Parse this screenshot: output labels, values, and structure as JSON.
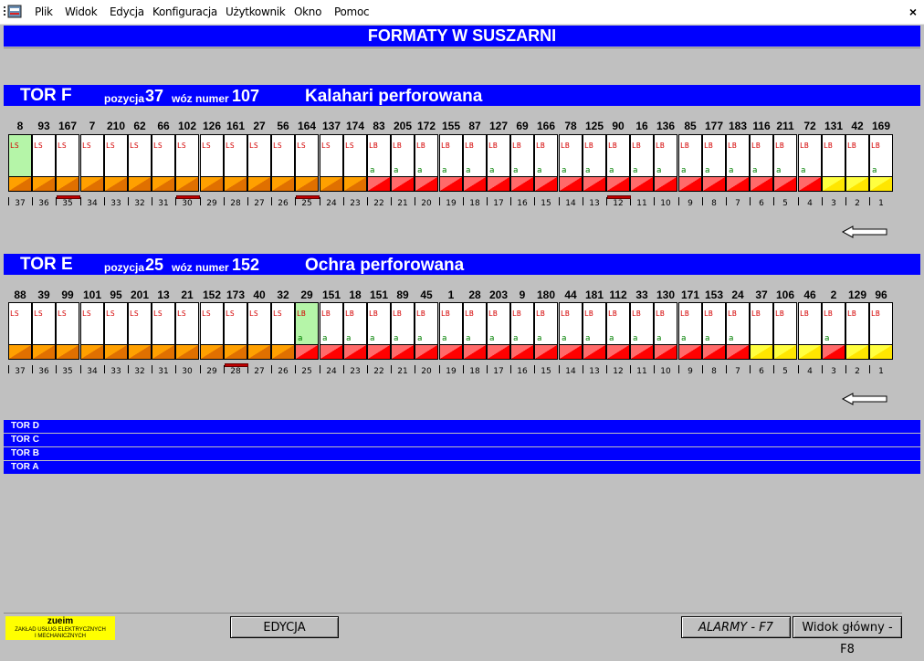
{
  "menu": {
    "items": [
      "Plik",
      "Widok",
      "Edycja",
      "Konfiguracja",
      "Użytkownik",
      "Okno",
      "Pomoc"
    ],
    "close_label": "×"
  },
  "title": "FORMATY W SUSZARNI",
  "tracks": [
    {
      "name": "TOR F",
      "position_label": "pozycja",
      "position": "37",
      "car_label": "wóz numer",
      "car_number": "107",
      "format": "Kalahari perforowana",
      "numbers": [
        "8",
        "93",
        "167",
        "7",
        "210",
        "62",
        "66",
        "102",
        "126",
        "161",
        "27",
        "56",
        "164",
        "137",
        "174",
        "83",
        "205",
        "172",
        "155",
        "87",
        "127",
        "69",
        "166",
        "78",
        "125",
        "90",
        "16",
        "136",
        "85",
        "177",
        "183",
        "116",
        "211",
        "72",
        "131",
        "42",
        "169"
      ],
      "codes": [
        "LS",
        "LS",
        "LS",
        "LS",
        "LS",
        "LS",
        "LS",
        "LS",
        "LS",
        "LS",
        "LS",
        "LS",
        "LS",
        "LS",
        "LS",
        "LB",
        "LB",
        "LB",
        "LB",
        "LB",
        "LB",
        "LB",
        "LB",
        "LB",
        "LB",
        "LB",
        "LB",
        "LB",
        "LB",
        "LB",
        "LB",
        "LB",
        "LB",
        "LB",
        "LB",
        "LB",
        "LB"
      ],
      "subs": [
        "",
        "",
        "",
        "",
        "",
        "",
        "",
        "",
        "",
        "",
        "",
        "",
        "",
        "",
        "",
        "a",
        "a",
        "a",
        "a",
        "a",
        "a",
        "a",
        "a",
        "a",
        "a",
        "a",
        "a",
        "a",
        "a",
        "a",
        "a",
        "a",
        "a",
        "a",
        "",
        "",
        "a"
      ],
      "colors": [
        "orange",
        "orange",
        "orange",
        "orange",
        "orange",
        "orange",
        "orange",
        "orange",
        "orange",
        "orange",
        "orange",
        "orange",
        "orange",
        "orange",
        "orange",
        "red",
        "red",
        "red",
        "red",
        "red",
        "red",
        "red",
        "red",
        "red",
        "red",
        "red",
        "red",
        "red",
        "red",
        "red",
        "red",
        "red",
        "red",
        "red",
        "yellow",
        "yellow",
        "yellow"
      ],
      "green_slot": 1,
      "positions": [
        "37",
        "36",
        "35",
        "34",
        "33",
        "32",
        "31",
        "30",
        "29",
        "28",
        "27",
        "26",
        "25",
        "24",
        "23",
        "22",
        "21",
        "20",
        "19",
        "18",
        "17",
        "16",
        "15",
        "14",
        "13",
        "12",
        "11",
        "10",
        "9",
        "8",
        "7",
        "6",
        "5",
        "4",
        "3",
        "2",
        "1"
      ],
      "markers": [
        3,
        8,
        13,
        26
      ]
    },
    {
      "name": "TOR E",
      "position_label": "pozycja",
      "position": "25",
      "car_label": "wóz numer",
      "car_number": "152",
      "format": "Ochra perforowana",
      "numbers": [
        "88",
        "39",
        "99",
        "101",
        "95",
        "201",
        "13",
        "21",
        "152",
        "173",
        "40",
        "32",
        "29",
        "151",
        "18",
        "151",
        "89",
        "45",
        "1",
        "28",
        "203",
        "9",
        "180",
        "44",
        "181",
        "112",
        "33",
        "130",
        "171",
        "153",
        "24",
        "37",
        "106",
        "46",
        "2",
        "129",
        "96"
      ],
      "codes": [
        "LS",
        "LS",
        "LS",
        "LS",
        "LS",
        "LS",
        "LS",
        "LS",
        "LS",
        "LS",
        "LS",
        "LS",
        "LB",
        "LB",
        "LB",
        "LB",
        "LB",
        "LB",
        "LB",
        "LB",
        "LB",
        "LB",
        "LB",
        "LB",
        "LB",
        "LB",
        "LB",
        "LB",
        "LB",
        "LB",
        "LB",
        "LB",
        "LB",
        "LB",
        "LB",
        "LB",
        "LB"
      ],
      "subs": [
        "",
        "",
        "",
        "",
        "",
        "",
        "",
        "",
        "",
        "",
        "",
        "",
        "a",
        "a",
        "a",
        "a",
        "a",
        "a",
        "a",
        "a",
        "a",
        "a",
        "a",
        "a",
        "a",
        "a",
        "a",
        "a",
        "a",
        "a",
        "a",
        "",
        "",
        "",
        "a",
        "",
        ""
      ],
      "colors": [
        "orange",
        "orange",
        "orange",
        "orange",
        "orange",
        "orange",
        "orange",
        "orange",
        "orange",
        "orange",
        "orange",
        "orange",
        "red",
        "red",
        "red",
        "red",
        "red",
        "red",
        "red",
        "red",
        "red",
        "red",
        "red",
        "red",
        "red",
        "red",
        "red",
        "red",
        "red",
        "red",
        "red",
        "yellow",
        "yellow",
        "yellow",
        "red",
        "yellow",
        "yellow"
      ],
      "green_slot": 13,
      "positions": [
        "37",
        "36",
        "35",
        "34",
        "33",
        "32",
        "31",
        "30",
        "29",
        "28",
        "27",
        "26",
        "25",
        "24",
        "23",
        "22",
        "21",
        "20",
        "19",
        "18",
        "17",
        "16",
        "15",
        "14",
        "13",
        "12",
        "11",
        "10",
        "9",
        "8",
        "7",
        "6",
        "5",
        "4",
        "3",
        "2",
        "1"
      ],
      "markers": [
        10
      ]
    }
  ],
  "other_tracks": [
    "TOR D",
    "TOR C",
    "TOR B",
    "TOR A"
  ],
  "logo": {
    "line1": "zueim",
    "line2": "ZAKŁAD USŁUG ELEKTRYCZNYCH",
    "line3": "I MECHANICZNYCH"
  },
  "buttons": {
    "edit": "EDYCJA",
    "alarms": "ALARMY - F7",
    "main_view": "Widok główny - F8"
  },
  "colors": {
    "orange": "#ffa000",
    "red": "#ff0000",
    "yellow": "#ffff00",
    "green": "#b5f5a8",
    "blue": "#0000ff"
  }
}
